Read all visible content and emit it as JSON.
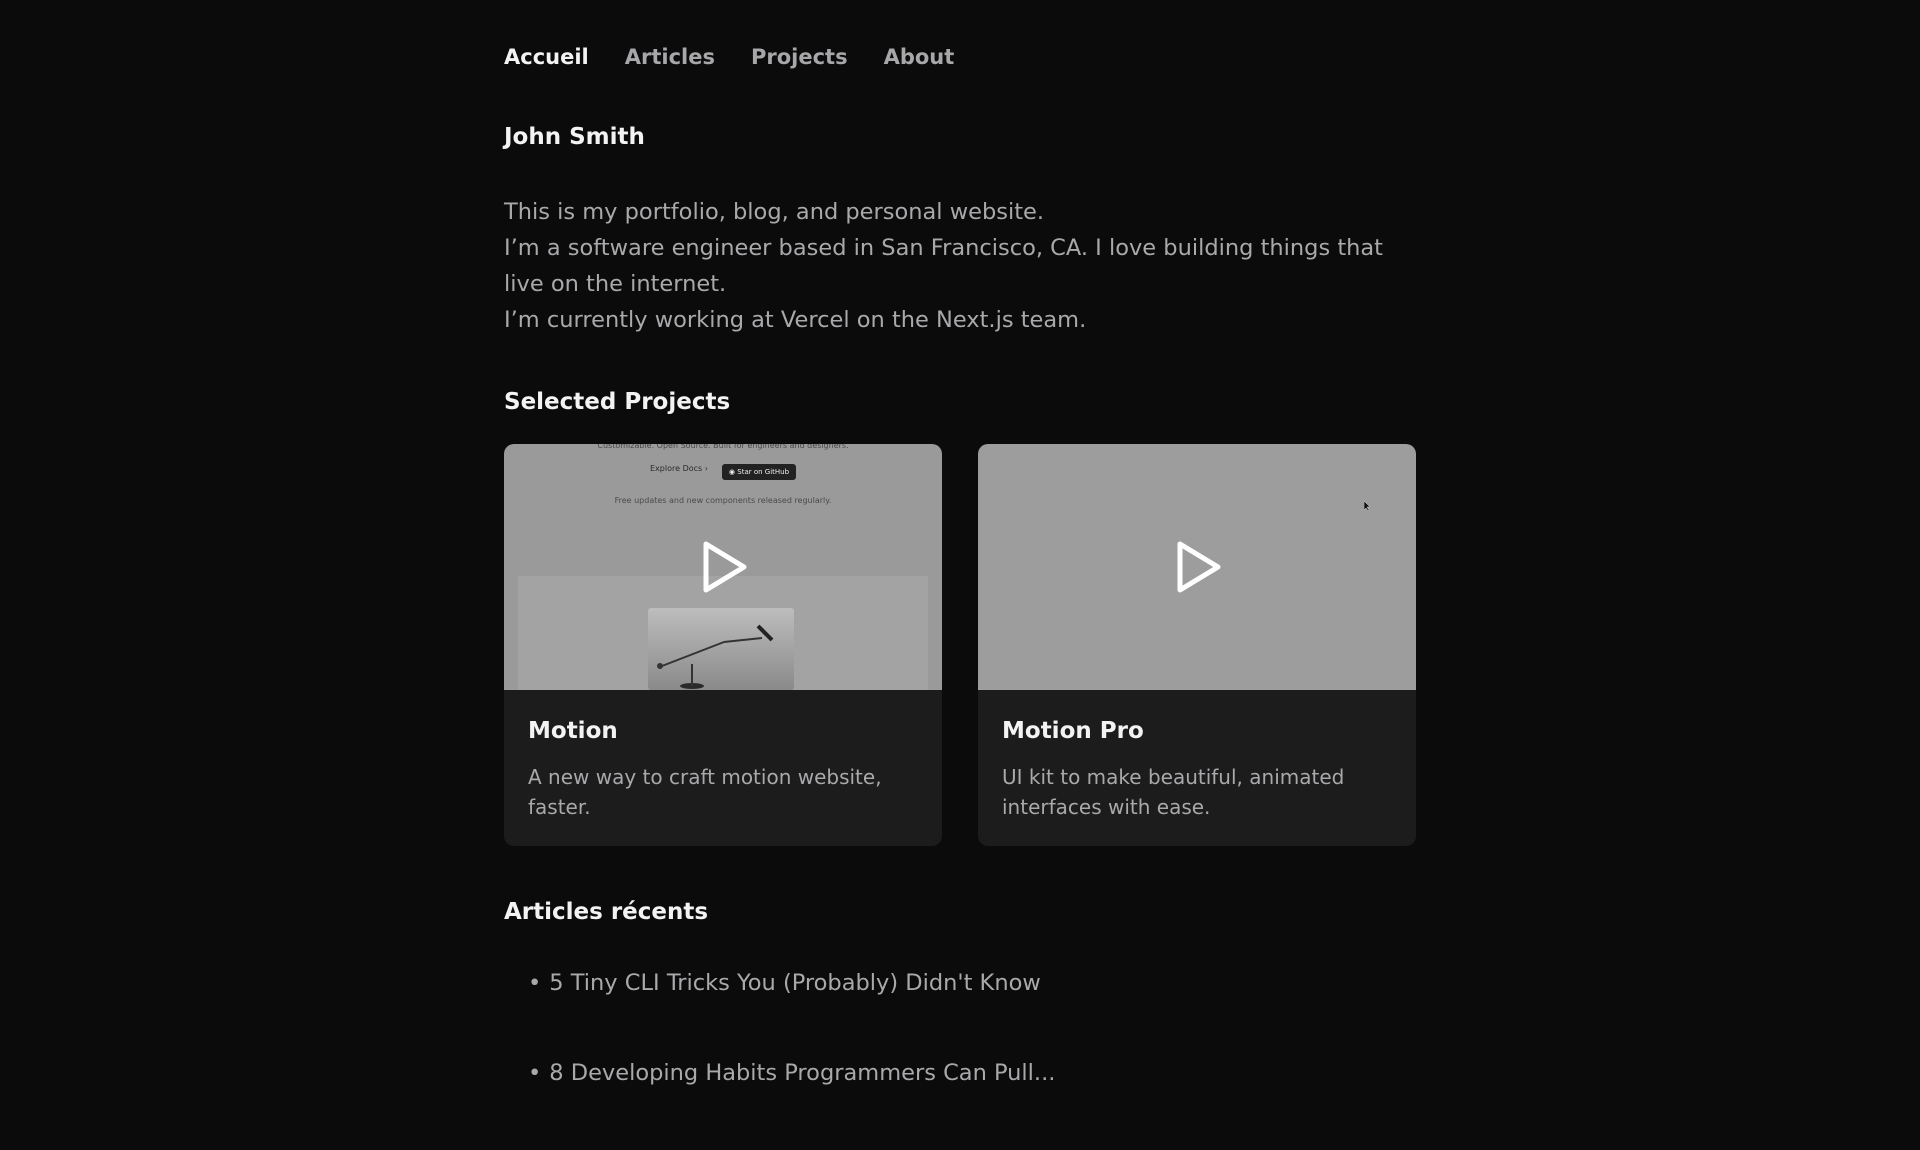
{
  "nav": {
    "items": [
      {
        "label": "Accueil",
        "active": true
      },
      {
        "label": "Articles",
        "active": false
      },
      {
        "label": "Projects",
        "active": false
      },
      {
        "label": "About",
        "active": false
      }
    ]
  },
  "profile": {
    "name": "John Smith",
    "intro": [
      "This is my portfolio, blog, and personal website.",
      "I’m a software engineer based in San Francisco, CA. I love building things that live on the internet.",
      "I’m currently working at Vercel on the Next.js team."
    ]
  },
  "projects": {
    "title": "Selected Projects",
    "items": [
      {
        "title": "Motion",
        "description": "A new way to craft motion website, faster.",
        "preview": {
          "top_text": "Customizable. Open Source. Built for engineers and designers.",
          "docs_label": "Explore Docs ›",
          "github_label": "Star on GitHub",
          "updates_text": "Free updates and new components released regularly."
        }
      },
      {
        "title": "Motion Pro",
        "description": "UI kit to make beautiful, animated interfaces with ease."
      }
    ],
    "play_icon": "play-icon"
  },
  "articles": {
    "title": "Articles récents",
    "items": [
      {
        "label": "5 Tiny CLI Tricks You (Probably) Didn't Know"
      },
      {
        "label": "8 Developing Habits Programmers Can Pull..."
      }
    ]
  },
  "colors": {
    "background": "#0b0b0c",
    "card": "#1c1c1d",
    "text_primary": "#f3f3f4",
    "text_secondary": "#a9a9ab"
  }
}
